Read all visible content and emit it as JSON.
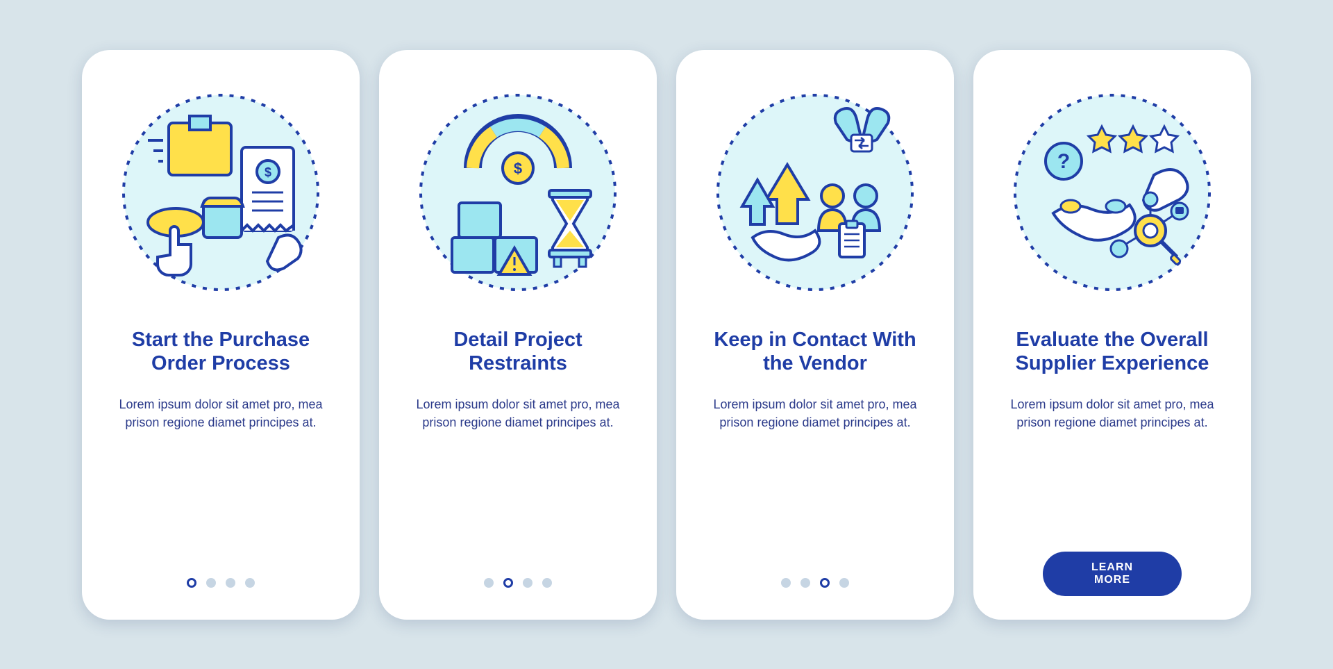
{
  "colors": {
    "navy": "#1f3da6",
    "yellow": "#ffe04a",
    "cyan": "#9ce6f0",
    "white": "#ffffff",
    "dotInactive": "#c6d5e3"
  },
  "cards": [
    {
      "icon": "purchase-order-icon",
      "title": "Start the Purchase Order Process",
      "description": "Lorem ipsum dolor sit amet pro, mea prison regione diamet principes at.",
      "pagerActive": 0,
      "hasButton": false
    },
    {
      "icon": "project-restraints-icon",
      "title": "Detail Project Restraints",
      "description": "Lorem ipsum dolor sit amet pro, mea prison regione diamet principes at.",
      "pagerActive": 1,
      "hasButton": false
    },
    {
      "icon": "vendor-contact-icon",
      "title": "Keep in Contact With the Vendor",
      "description": "Lorem ipsum dolor sit amet pro, mea prison regione diamet principes at.",
      "pagerActive": 2,
      "hasButton": false
    },
    {
      "icon": "supplier-experience-icon",
      "title": "Evaluate the Overall Supplier Experience",
      "description": "Lorem ipsum dolor sit amet pro, mea prison regione diamet principes at.",
      "pagerActive": 3,
      "hasButton": true,
      "buttonLabel": "LEARN MORE"
    }
  ],
  "pagerCount": 4
}
